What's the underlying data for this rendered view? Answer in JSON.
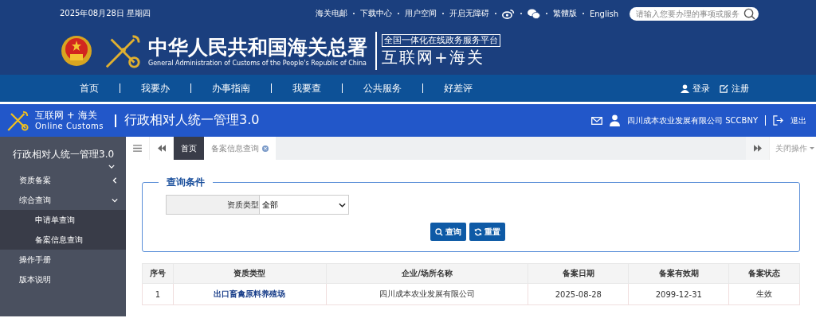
{
  "top_bar": {
    "date": "2025年08月28日 星期四",
    "links_left": [
      "海关电邮",
      "下载中心",
      "用户空间",
      "开启无障碍"
    ],
    "links_right": [
      "繁體版",
      "English"
    ],
    "search": {
      "placeholder": "请输入您要办理的事项或服务"
    }
  },
  "header": {
    "title": "中华人民共和国海关总署",
    "subtitle": "General Administration of Customs of the People's Republic of China",
    "platform_box": "全国一体化在线政务服务平台",
    "platform_name": "互联网+海关"
  },
  "nav": {
    "items": [
      "首页",
      "我要办",
      "办事指南",
      "我要查",
      "公共服务",
      "好差评"
    ],
    "login": "登录",
    "register": "注册"
  },
  "app_bar": {
    "brand": "互联网 + 海关",
    "brand_en": "Online Customs",
    "title": "行政相对人统一管理3.0",
    "user": "四川成本农业发展有限公司 SCCBNY",
    "logout": "退出"
  },
  "sidebar": {
    "title": "行政相对人统一管理3.0",
    "items": [
      {
        "label": "资质备案",
        "expanded": false
      },
      {
        "label": "综合查询",
        "expanded": true,
        "children": [
          {
            "label": "申请单查询"
          },
          {
            "label": "备案信息查询"
          }
        ]
      },
      {
        "label": "操作手册"
      },
      {
        "label": "版本说明"
      }
    ]
  },
  "tabs": [
    {
      "label": "首页",
      "selected": true,
      "closable": false
    },
    {
      "label": "备案信息查询",
      "selected": false,
      "closable": true
    }
  ],
  "close_menu": "关闭操作",
  "query": {
    "legend": "查询条件",
    "field_label": "资质类型",
    "field_value": "全部",
    "buttons": [
      {
        "kind": "search",
        "label": "查询"
      },
      {
        "kind": "reset",
        "label": "重置"
      }
    ]
  },
  "table": {
    "columns": [
      "序号",
      "资质类型",
      "企业/场所名称",
      "备案日期",
      "备案有效期",
      "备案状态"
    ],
    "rows": [
      [
        "1",
        "出口畜禽原料养殖场",
        "四川成本农业发展有限公司",
        "2025-08-28",
        "2099-12-31",
        "生效"
      ]
    ]
  }
}
